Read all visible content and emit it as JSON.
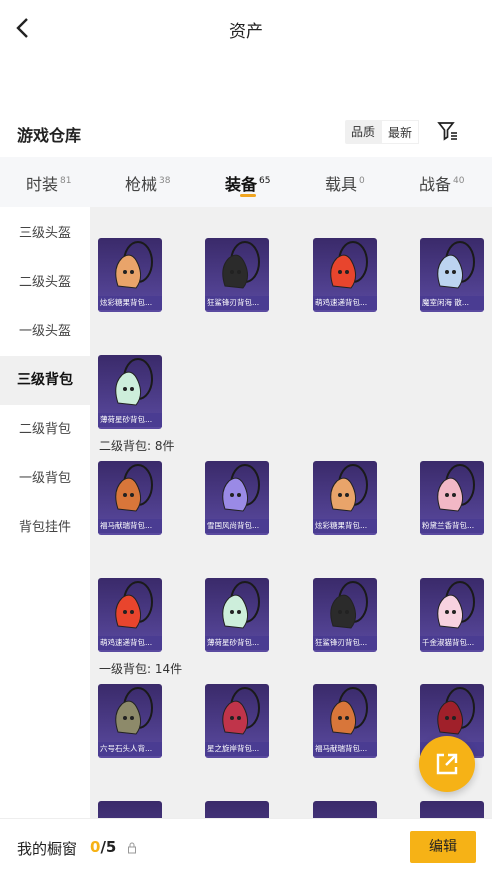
{
  "header": {
    "title": "资产"
  },
  "warehouse": {
    "title": "游戏仓库",
    "sort_quality": "品质",
    "sort_latest": "最新"
  },
  "tabs": [
    {
      "label": "时装",
      "count": "81"
    },
    {
      "label": "枪械",
      "count": "38"
    },
    {
      "label": "装备",
      "count": "65"
    },
    {
      "label": "载具",
      "count": "0"
    },
    {
      "label": "战备",
      "count": "40"
    }
  ],
  "sidebar": [
    {
      "label": "三级头盔"
    },
    {
      "label": "二级头盔"
    },
    {
      "label": "一级头盔"
    },
    {
      "label": "三级背包"
    },
    {
      "label": "二级背包"
    },
    {
      "label": "一级背包"
    },
    {
      "label": "背包挂件"
    }
  ],
  "sections": {
    "level2_backpack": "二级背包: 8件",
    "level1_backpack": "一级背包: 14件"
  },
  "items": [
    {
      "name": "炫彩糖果背包...",
      "icon": "rabbit-backpack-icon",
      "color": "#e9a46a"
    },
    {
      "name": "狂鲨锋刃背包...",
      "icon": "shark-backpack-icon",
      "color": "#2b2b2b"
    },
    {
      "name": "萌鸡速递背包...",
      "icon": "chick-backpack-icon",
      "color": "#e8452d"
    },
    {
      "name": "魔室闲海 散...",
      "icon": "orb-backpack-icon",
      "color": "#bcd4f0"
    },
    {
      "name": "薄荷星砂背包...",
      "icon": "mint-backpack-icon",
      "color": "#cdeedb"
    },
    {
      "name": "福马献瑞背包...",
      "icon": "horse-backpack-icon",
      "color": "#d8763a"
    },
    {
      "name": "雪国风尚背包...",
      "icon": "snow-backpack-icon",
      "color": "#9a8ae6"
    },
    {
      "name": "炫彩糖果背包...",
      "icon": "rabbit-backpack-icon",
      "color": "#e9a46a"
    },
    {
      "name": "粉黛兰香背包...",
      "icon": "flower-backpack-icon",
      "color": "#f2b8c6"
    },
    {
      "name": "萌鸡速递背包...",
      "icon": "chick-backpack-icon",
      "color": "#e8452d"
    },
    {
      "name": "薄荷星砂背包...",
      "icon": "mint-backpack-icon",
      "color": "#cdeedb"
    },
    {
      "name": "狂鲨锋刃背包...",
      "icon": "shark-backpack-icon",
      "color": "#2b2b2b"
    },
    {
      "name": "千金淑猫背包...",
      "icon": "cat-backpack-icon",
      "color": "#f7d2e0"
    },
    {
      "name": "六号石头人背...",
      "icon": "stone-backpack-icon",
      "color": "#8d8a6a"
    },
    {
      "name": "星之旋岸背包...",
      "icon": "star-backpack-icon",
      "color": "#c0344a"
    },
    {
      "name": "福马献瑞背包...",
      "icon": "horse-backpack-icon",
      "color": "#d8763a"
    },
    {
      "name": "...包...",
      "icon": "demon-backpack-icon",
      "color": "#a0202a"
    }
  ],
  "bottom": {
    "showcase_label": "我的橱窗",
    "count_current": "0",
    "count_total": "/5",
    "edit_label": "编辑"
  },
  "colors": {
    "accent": "#f6b216",
    "card_bg": "#4a3c92"
  }
}
